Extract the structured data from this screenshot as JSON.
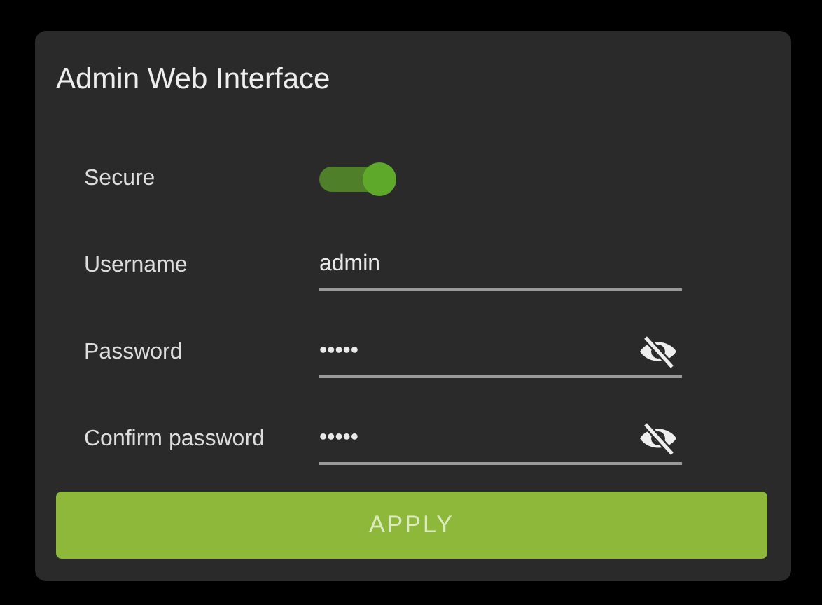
{
  "panel": {
    "title": "Admin Web Interface"
  },
  "fields": [
    {
      "kind": "toggle",
      "label": "Secure",
      "on": true
    },
    {
      "kind": "text",
      "label": "Username",
      "value": "admin"
    },
    {
      "kind": "password",
      "label": "Password",
      "value": "•••••",
      "revealed": false
    },
    {
      "kind": "password",
      "label": "Confirm password",
      "value": "•••••",
      "revealed": false
    }
  ],
  "apply_button": {
    "label": "APPLY"
  }
}
